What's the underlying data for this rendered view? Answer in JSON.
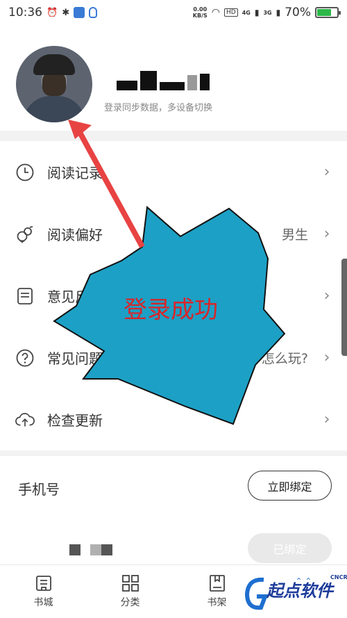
{
  "status_bar": {
    "time": "10:36",
    "net_speed": "0.00",
    "net_unit": "KB/S",
    "hd": "HD",
    "signal1": "4G",
    "signal2": "3G",
    "battery": "70%",
    "battery_level": 0.7
  },
  "profile": {
    "subtitle": "登录同步数据，多设备切换"
  },
  "menu": {
    "items": [
      {
        "label": "阅读记录",
        "value": "",
        "icon": "clock-icon"
      },
      {
        "label": "阅读偏好",
        "value": "男生",
        "icon": "gender-icon"
      },
      {
        "label": "意见反馈",
        "value": "",
        "icon": "feedback-icon"
      },
      {
        "label": "常见问题",
        "value": "怎么玩?",
        "icon": "help-icon"
      },
      {
        "label": "检查更新",
        "value": "",
        "icon": "cloud-upload-icon"
      }
    ]
  },
  "phone": {
    "label": "手机号",
    "bind_button": "立即绑定",
    "bound_button": "已绑定"
  },
  "tabbar": {
    "items": [
      {
        "label": "书城",
        "icon": "bookstore-icon"
      },
      {
        "label": "分类",
        "icon": "grid-icon"
      },
      {
        "label": "书架",
        "icon": "bookshelf-icon"
      }
    ]
  },
  "overlay": {
    "burst_text": "登录成功",
    "colors": {
      "burst_fill": "#1da0c5",
      "arrow": "#e84343",
      "text": "#d7262a"
    }
  },
  "watermark": {
    "text": "起点软件",
    "small": "CNCRK"
  }
}
